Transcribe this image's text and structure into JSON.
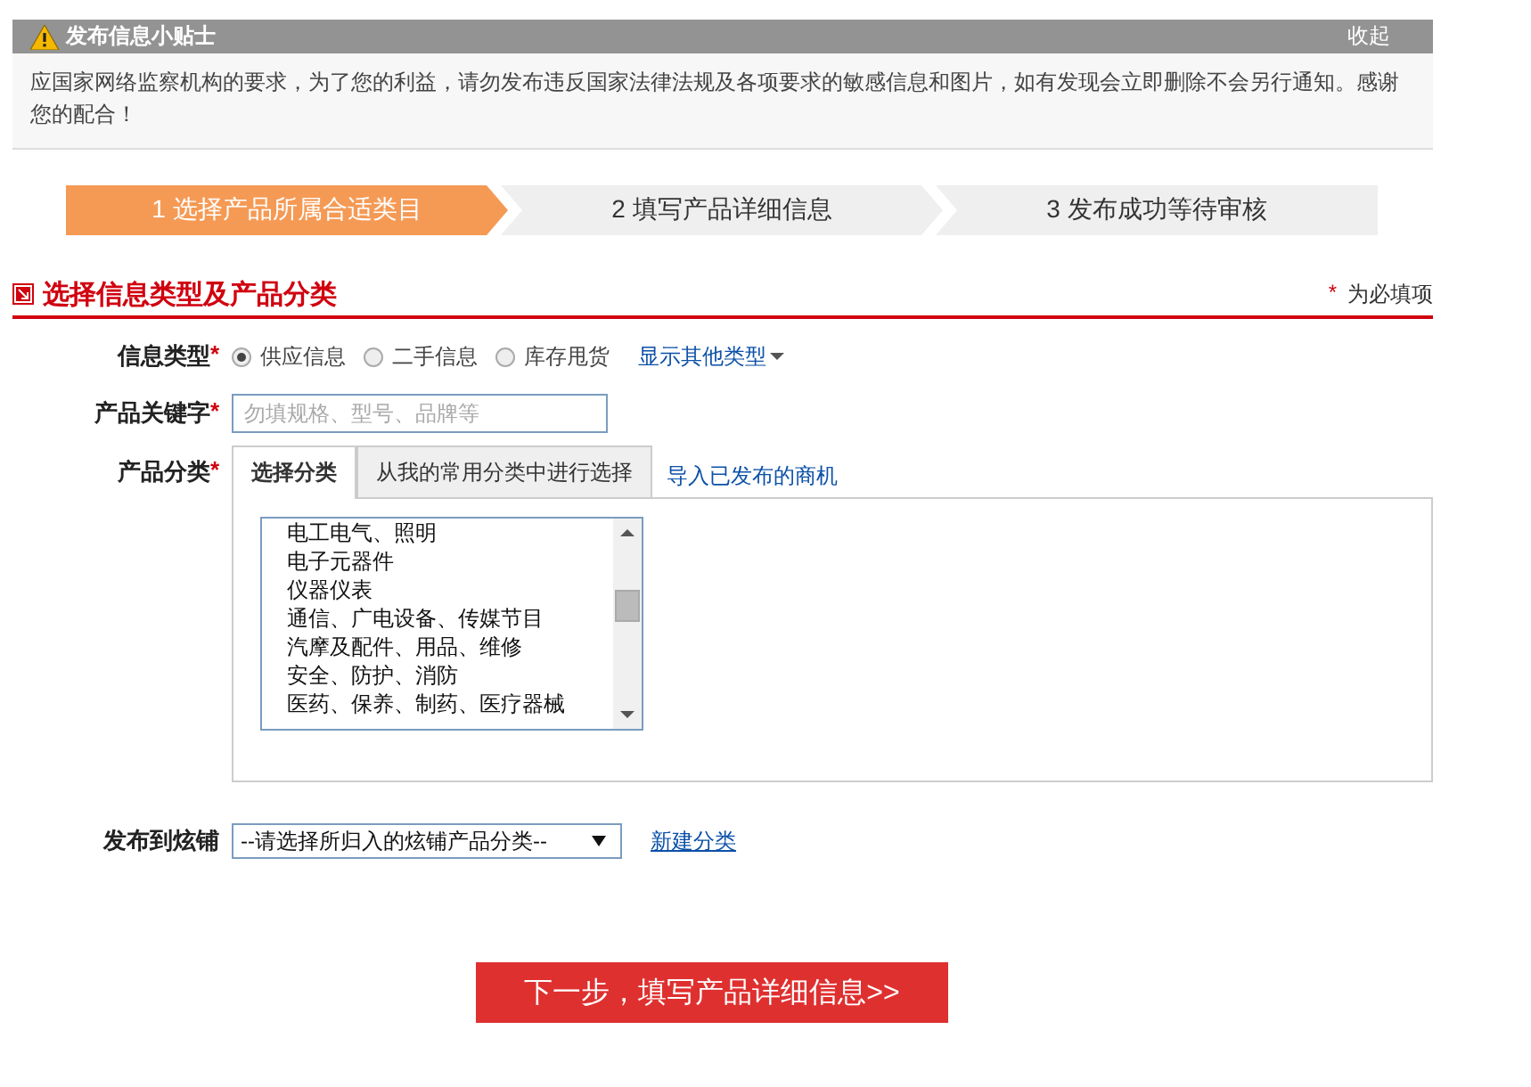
{
  "tips": {
    "title": "发布信息小贴士",
    "collapse": "收起",
    "text": "应国家网络监察机构的要求，为了您的利益，请勿发布违反国家法律法规及各项要求的敏感信息和图片，如有发现会立即删除不会另行通知。感谢您的配合！"
  },
  "steps": [
    {
      "label": "1 选择产品所属合适类目",
      "selected": true
    },
    {
      "label": "2 填写产品详细信息",
      "selected": false
    },
    {
      "label": "3 发布成功等待审核",
      "selected": false
    }
  ],
  "section": {
    "title": "选择信息类型及产品分类",
    "required_mark": "*",
    "required_note": "为必填项"
  },
  "info_type": {
    "label": "信息类型",
    "mark": "*",
    "options": [
      {
        "label": "供应信息",
        "selected": true
      },
      {
        "label": "二手信息",
        "selected": false
      },
      {
        "label": "库存甩货",
        "selected": false
      }
    ],
    "more_link": "显示其他类型"
  },
  "keyword": {
    "label": "产品关键字",
    "mark": "*",
    "placeholder": "勿填规格、型号、品牌等"
  },
  "category": {
    "label": "产品分类",
    "mark": "*",
    "tabs": [
      {
        "label": "选择分类",
        "selected": true
      },
      {
        "label": "从我的常用分类中进行选择",
        "selected": false
      }
    ],
    "import_link": "导入已发布的商机",
    "items": [
      "电工电气、照明",
      "电子元器件",
      "仪器仪表",
      "通信、广电设备、传媒节目",
      "汽摩及配件、用品、维修",
      "安全、防护、消防",
      "医药、保养、制药、医疗器械"
    ]
  },
  "shop": {
    "label": "发布到炫铺",
    "select": "--请选择所归入的炫铺产品分类--",
    "new_link": "新建分类"
  },
  "next_button": "下一步，填写产品详细信息>>"
}
